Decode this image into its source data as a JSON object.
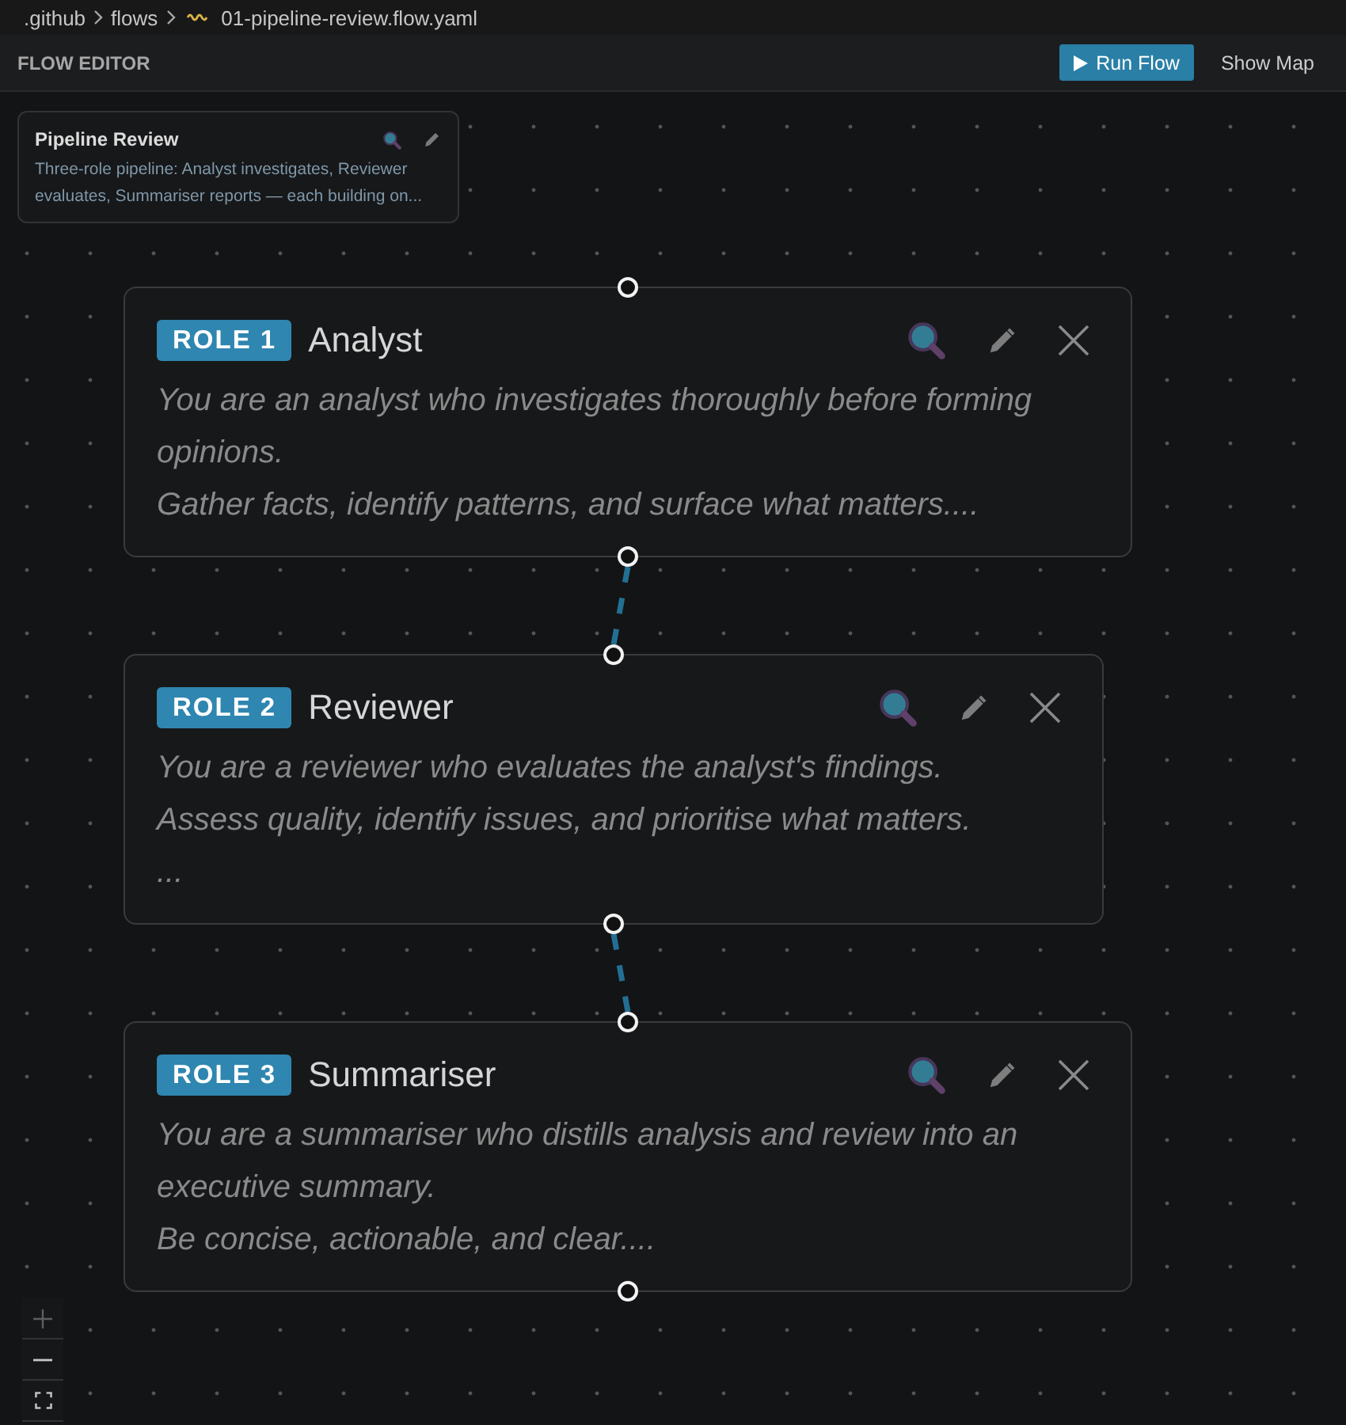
{
  "breadcrumb": {
    "folders": [
      ".github",
      "flows"
    ],
    "file": "01-pipeline-review.flow.yaml"
  },
  "toolbar": {
    "title": "FLOW EDITOR",
    "buttons": [
      {
        "label": "Run Flow",
        "kind": "primary"
      },
      {
        "label": "Show Map",
        "kind": "plain"
      }
    ]
  },
  "flow_card": {
    "title": "Pipeline Review",
    "description": "Three-role pipeline: Analyst investigates, Reviewer evaluates, Summariser reports — each building on..."
  },
  "nodes": [
    {
      "badge": "ROLE 1",
      "name": "Analyst",
      "description": "You are an analyst who investigates thoroughly before forming opinions.\nGather facts, identify patterns, and surface what matters...."
    },
    {
      "badge": "ROLE 2",
      "name": "Reviewer",
      "description": "You are a reviewer who evaluates the analyst's findings.\nAssess quality, identify issues, and prioritise what matters.\n..."
    },
    {
      "badge": "ROLE 3",
      "name": "Summariser",
      "description": "You are a summariser who distills analysis and review into an executive summary.\nBe concise, actionable, and clear...."
    }
  ]
}
